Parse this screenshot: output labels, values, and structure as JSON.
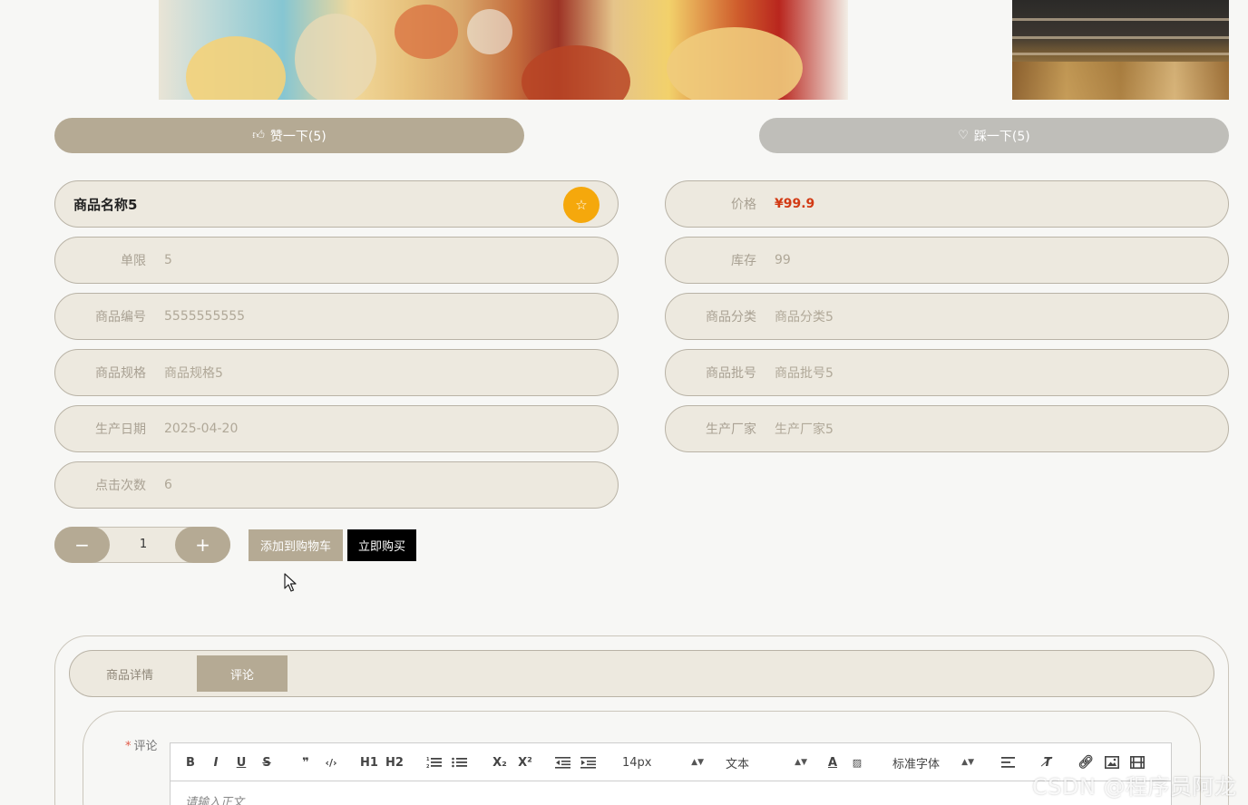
{
  "vote": {
    "like_label": "赞一下(5)",
    "dislike_label": "踩一下(5)"
  },
  "product": {
    "name": "商品名称5",
    "fields_left": [
      {
        "label": "单限",
        "value": "5"
      },
      {
        "label": "商品编号",
        "value": "5555555555"
      },
      {
        "label": "商品规格",
        "value": "商品规格5"
      },
      {
        "label": "生产日期",
        "value": "2025-04-20"
      },
      {
        "label": "点击次数",
        "value": "6"
      }
    ],
    "fields_right": [
      {
        "label": "价格",
        "value": "¥99.9"
      },
      {
        "label": "库存",
        "value": "99"
      },
      {
        "label": "商品分类",
        "value": "商品分类5"
      },
      {
        "label": "商品批号",
        "value": "商品批号5"
      },
      {
        "label": "生产厂家",
        "value": "生产厂家5"
      }
    ]
  },
  "purchase": {
    "minus": "−",
    "plus": "+",
    "quantity": "1",
    "add_to_cart": "添加到购物车",
    "buy_now": "立即购买"
  },
  "tabs": [
    {
      "label": "商品详情",
      "active": false
    },
    {
      "label": "评论",
      "active": true
    }
  ],
  "review": {
    "required_mark": "*",
    "label": "评论",
    "placeholder": "请输入正文"
  },
  "toolbar": {
    "font_size": "14px",
    "block_type": "文本",
    "font_family": "标准字体",
    "items": [
      "B",
      "I",
      "U",
      "S",
      "❞",
      "‹/›",
      "H1",
      "H2",
      "ordered-list",
      "bullet-list",
      "X₂",
      "X²",
      "outdent",
      "indent",
      "font-color",
      "background-color",
      "align",
      "clear-format",
      "link",
      "image",
      "video"
    ]
  },
  "watermark": "CSDN @程序员阿龙",
  "colors": {
    "accent": "#b5aa94",
    "pill_bg": "#ede9df",
    "price": "#d23a14",
    "star": "#f5a80c"
  }
}
